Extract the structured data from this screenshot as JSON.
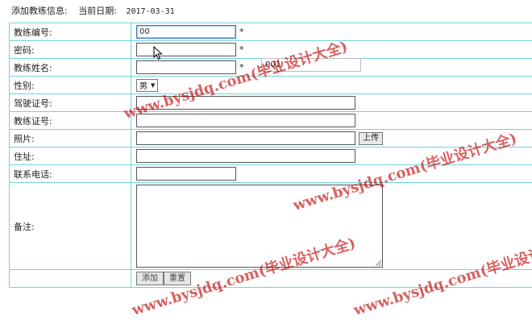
{
  "header": {
    "title": "添加教练信息:",
    "date_label": "当前日期:",
    "date_value": "2017-03-31"
  },
  "form": {
    "coach_id": {
      "label": "教练编号:",
      "value": "00",
      "required_mark": "*"
    },
    "autocomplete_suggestion": "001",
    "password": {
      "label": "密码:",
      "required_mark": "*"
    },
    "coach_name": {
      "label": "教练姓名:",
      "value": "",
      "required_mark": "*"
    },
    "gender": {
      "label": "性别:",
      "selected": "男"
    },
    "driver_license": {
      "label": "驾驶证号:",
      "value": ""
    },
    "coach_license": {
      "label": "教练证号:",
      "value": ""
    },
    "photo": {
      "label": "照片:",
      "value": "",
      "upload_label": "上传"
    },
    "address": {
      "label": "住址:",
      "value": ""
    },
    "phone": {
      "label": "联系电话:",
      "value": ""
    },
    "remarks": {
      "label": "备注:",
      "value": ""
    }
  },
  "buttons": {
    "submit_label": "添加",
    "reset_label": "重置"
  },
  "watermarks": [
    "www.bysjdq.com(毕业设计大全)",
    "www.bysjdq.com(毕业设计大全)",
    "www.bysjdq.com(毕业设计大全)",
    "www.bysjdq.com(毕业设计大全)"
  ],
  "colors": {
    "table_border": "#6fd3d8",
    "watermark": "#be0000",
    "focus_border": "#3b7bd4"
  }
}
